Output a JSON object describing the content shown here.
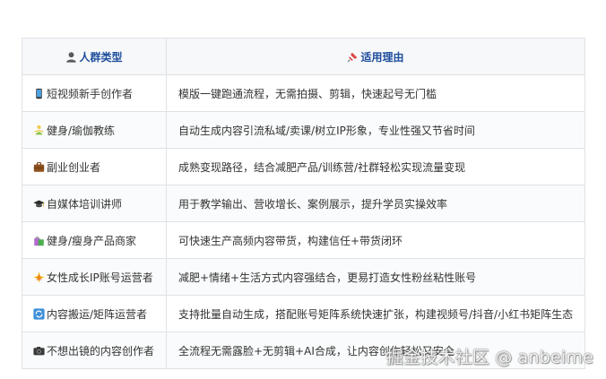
{
  "header": {
    "col1_icon": "bust-silhouette-icon",
    "col1_label": "人群类型",
    "col2_icon": "pushpin-icon",
    "col2_label": "适用理由"
  },
  "rows": [
    {
      "icon": "mobile-phone-icon",
      "type": "短视频新手创作者",
      "reason": "模版一键跑通流程，无需拍摄、剪辑，快速起号无门槛"
    },
    {
      "icon": "person-yoga-icon",
      "type": "健身/瑜伽教练",
      "reason": "自动生成内容引流私域/卖课/树立IP形象，专业性强又节省时间"
    },
    {
      "icon": "briefcase-icon",
      "type": "副业创业者",
      "reason": "成熟变现路径，结合减肥产品/训练营/社群轻松实现流量变现"
    },
    {
      "icon": "graduation-cap-icon",
      "type": "自媒体培训讲师",
      "reason": "用于教学输出、营收增长、案例展示，提升学员实操效率"
    },
    {
      "icon": "shopping-bags-icon",
      "type": "健身/瘦身产品商家",
      "reason": "可快速生产高频内容带货，构建信任+带货闭环"
    },
    {
      "icon": "sparkle-star-icon",
      "type": "女性成长IP账号运营者",
      "reason": "减肥+情绪+生活方式内容强结合，更易打造女性粉丝粘性账号"
    },
    {
      "icon": "refresh-arrows-icon",
      "type": "内容搬运/矩阵运营者",
      "reason": "支持批量自动生成，搭配账号矩阵系统快速扩张，构建视频号/抖音/小红书矩阵生态"
    },
    {
      "icon": "camera-icon",
      "type": "不想出镜的内容创作者",
      "reason": "全流程无需露脸+无剪辑+AI合成，让内容创作轻松又安全"
    }
  ],
  "watermark": "掘金技术社区 @ anbeime"
}
